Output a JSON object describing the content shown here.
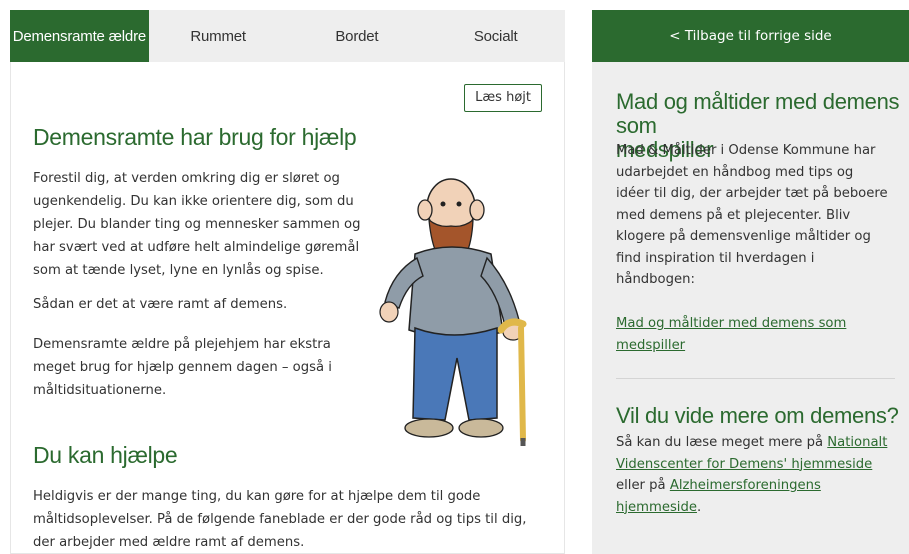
{
  "tabs": [
    "Demensramte ældre",
    "Rummet",
    "Bordet",
    "Socialt"
  ],
  "read_aloud": "Læs højt",
  "section1": {
    "title": "Demensramte har brug for hjælp",
    "p1_lines": [
      "Forestil dig, at verden omkring dig er sløret og",
      "ugenkendelig. Du kan ikke orientere dig, som du",
      "plejer. Du blander ting og mennesker sammen og",
      "har svært ved at udføre helt almindelige gøremål",
      "som at tænde lyset, lyne en lynlås og spise."
    ],
    "p2": "Sådan er det at være ramt af demens.",
    "p3_lines": [
      "Demensramte ældre på plejehjem har ekstra",
      "meget brug for hjælp gennem dagen – også i",
      "måltidsituationerne."
    ]
  },
  "section2": {
    "title": "Du kan hjælpe",
    "p1_lines": [
      "Heldigvis er der mange ting, du kan gøre for at hjælpe dem til gode",
      "måltidsoplevelser. På de følgende faneblade er der gode råd og tips til dig,",
      "der arbejder med ældre ramt af demens."
    ]
  },
  "sidebar": {
    "back_label": "< Tilbage til forrige side",
    "box1": {
      "title_lines": [
        "Mad og måltider med demens som",
        "medspiller"
      ],
      "text_lines": [
        "Mad & Måltider i Odense Kommune har",
        "udarbejdet en håndbog med tips og",
        "idéer til dig, der arbejder tæt på beboere",
        "med demens på et plejecenter. Bliv",
        "klogere på demensvenlige måltider og",
        "find inspiration til hverdagen i",
        "håndbogen:"
      ],
      "link_lines": [
        "Mad og måltider med demens som",
        "medspiller"
      ]
    },
    "box2": {
      "title": "Vil du vide mere om demens?",
      "line1_text": "Så kan du læse meget mere på ",
      "line1_link": "Nationalt",
      "line2_link": "Videnscenter for Demens' hjemmeside",
      "line3_text": "eller på ",
      "line3_link": "Alzheimersforeningens",
      "line4_link": "hjemmeside",
      "line4_text": "."
    }
  },
  "colors": {
    "accent": "#2b6a2f",
    "tab_bg": "#eeeeee",
    "sidebar_bg": "#eeeeee"
  },
  "illustration": "elderly-man-with-cane-illustration"
}
